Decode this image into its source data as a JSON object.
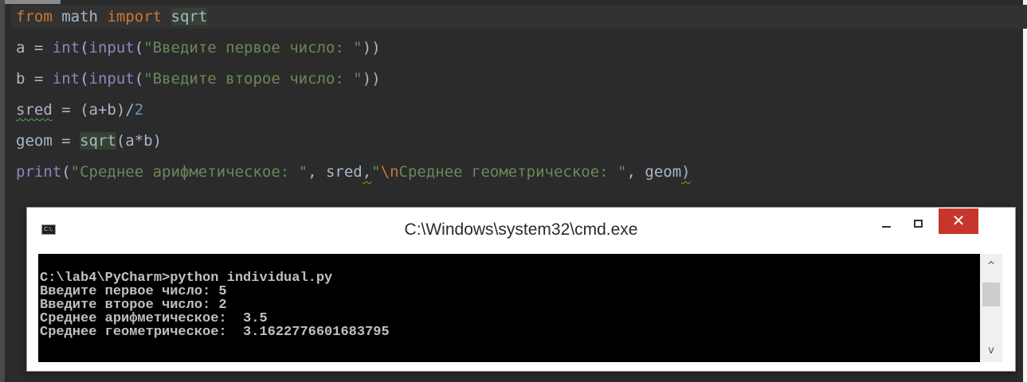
{
  "editor": {
    "line1": {
      "kw1": "from",
      "mod": "math",
      "kw2": "import",
      "name": "sqrt"
    },
    "line2": {
      "lhs": "a = ",
      "fn1": "int",
      "p1": "(",
      "fn2": "input",
      "p2": "(",
      "str": "\"Введите первое число: \"",
      "end": "))"
    },
    "line3": {
      "lhs": "b = ",
      "fn1": "int",
      "p1": "(",
      "fn2": "input",
      "p2": "(",
      "str": "\"Введите второе число: \"",
      "end": "))"
    },
    "line4": {
      "var": "sred",
      "rest": " = (a+b)/",
      "num": "2"
    },
    "line5": {
      "lhs": "geom = ",
      "fn": "sqrt",
      "rest": "(a*b)"
    },
    "line6": {
      "fn": "print",
      "p1": "(",
      "str1": "\"Среднее арифметическое: \"",
      "c1": ", sred",
      "comma": ",",
      "q": "\"",
      "esc": "\\n",
      "str2": "Среднее геометрическое: \"",
      "c2": ", geom",
      "close": ")"
    }
  },
  "cmd": {
    "title": "C:\\Windows\\system32\\cmd.exe",
    "icon_text": "C:\\.",
    "close_glyph": "✕",
    "scroll_up_glyph": "^",
    "scroll_down_glyph": "v",
    "lines": [
      "C:\\lab4\\PyCharm>python individual.py",
      "Введите первое число: 5",
      "Введите второе число: 2",
      "Среднее арифметическое:  3.5",
      "Среднее геометрическое:  3.1622776601683795"
    ]
  },
  "icons": {
    "app": "cmd-icon",
    "minimize": "minimize-icon",
    "maximize": "maximize-icon",
    "close": "close-icon"
  },
  "colors": {
    "editor_bg": "#2b2b2b",
    "keyword": "#cc7832",
    "builtin": "#8888c6",
    "string": "#6a8759",
    "number": "#6897bb",
    "close_button": "#c7362b",
    "console_bg": "#000000",
    "console_text": "#c0c0c0"
  }
}
